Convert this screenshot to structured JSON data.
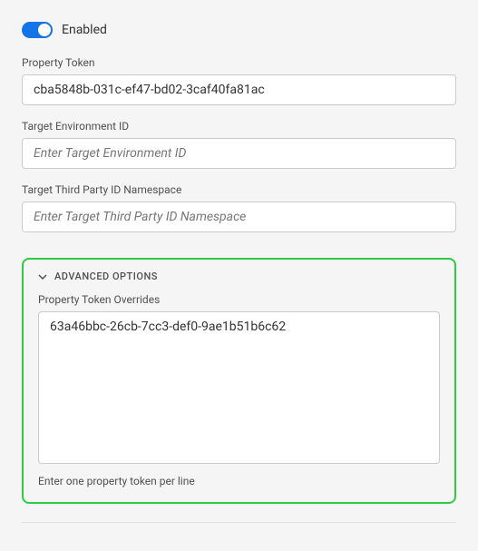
{
  "toggle": {
    "label": "Enabled",
    "checked": true
  },
  "fields": {
    "propertyToken": {
      "label": "Property Token",
      "value": "cba5848b-031c-ef47-bd02-3caf40fa81ac",
      "placeholder": ""
    },
    "targetEnvironmentId": {
      "label": "Target Environment ID",
      "value": "",
      "placeholder": "Enter Target Environment ID"
    },
    "targetThirdPartyIdNamespace": {
      "label": "Target Third Party ID Namespace",
      "value": "",
      "placeholder": "Enter Target Third Party ID Namespace"
    }
  },
  "advanced": {
    "title": "ADVANCED OPTIONS",
    "propertyTokenOverrides": {
      "label": "Property Token Overrides",
      "value": "63a46bbc-26cb-7cc3-def0-9ae1b51b6c62",
      "helper": "Enter one property token per line"
    }
  },
  "colors": {
    "accent": "#1473e6",
    "highlight": "#2ecc40"
  }
}
